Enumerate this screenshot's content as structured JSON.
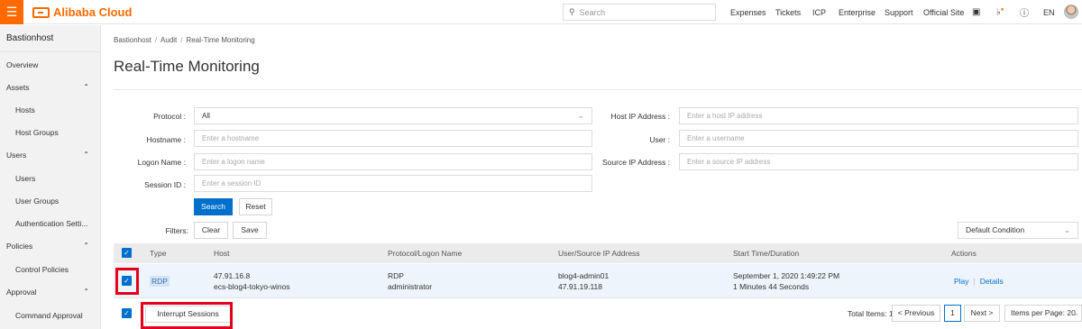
{
  "topbar": {
    "menu_icon": "☰",
    "brand": "Alibaba Cloud",
    "search_placeholder": "Search",
    "nav": [
      "Expenses",
      "Tickets",
      "ICP",
      "Enterprise",
      "Support",
      "Official Site"
    ],
    "lang": "EN",
    "accent": "#ff6a00"
  },
  "sidebar": {
    "title": "Bastionhost",
    "items": [
      {
        "label": "Overview",
        "level": 1
      },
      {
        "label": "Assets",
        "level": 1,
        "expanded": true
      },
      {
        "label": "Hosts",
        "level": 2
      },
      {
        "label": "Host Groups",
        "level": 2
      },
      {
        "label": "Users",
        "level": 1,
        "expanded": true
      },
      {
        "label": "Users",
        "level": 2
      },
      {
        "label": "User Groups",
        "level": 2
      },
      {
        "label": "Authentication Setti...",
        "level": 2
      },
      {
        "label": "Policies",
        "level": 1,
        "expanded": true
      },
      {
        "label": "Control Policies",
        "level": 2
      },
      {
        "label": "Approval",
        "level": 1,
        "expanded": true
      },
      {
        "label": "Command Approval",
        "level": 2
      }
    ]
  },
  "breadcrumb": [
    "Bastionhost",
    "Audit",
    "Real-Time Monitoring"
  ],
  "page_title": "Real-Time Monitoring",
  "filters": {
    "protocol_label": "Protocol",
    "protocol_value": "All",
    "hostname_label": "Hostname",
    "hostname_placeholder": "Enter a hostname",
    "logon_label": "Logon Name",
    "logon_placeholder": "Enter a logon name",
    "session_label": "Session ID",
    "session_placeholder": "Enter a session ID",
    "host_ip_label": "Host IP Address",
    "host_ip_placeholder": "Enter a host IP address",
    "user_label": "User",
    "user_placeholder": "Enter a username",
    "source_ip_label": "Source IP Address",
    "source_ip_placeholder": "Enter a source IP address",
    "search_btn": "Search",
    "reset_btn": "Reset",
    "filters_label": "Filters",
    "clear_btn": "Clear",
    "save_btn": "Save",
    "condition_select": "Default Condition"
  },
  "table": {
    "columns": [
      "Type",
      "Host",
      "Protocol/Logon Name",
      "User/Source IP Address",
      "Start Time/Duration",
      "Actions"
    ],
    "rows": [
      {
        "type": "RDP",
        "host_ip": "47.91.16.8",
        "host_name": "ecs-blog4-tokyo-winos",
        "protocol": "RDP",
        "logon": "administrator",
        "user": "blog4-admin01",
        "source_ip": "47.91.19.118",
        "start": "September 1, 2020 1:49:22 PM",
        "duration": "1 Minutes 44 Seconds",
        "action_play": "Play",
        "action_details": "Details",
        "selected": true
      }
    ],
    "interrupt_btn": "Interrupt Sessions"
  },
  "pager": {
    "total_label": "Total Items: 1",
    "prev": "Previous",
    "current": "1",
    "next": "Next",
    "per_page": "Items per Page: 20"
  },
  "colors": {
    "primary": "#0070cc",
    "highlight": "#e4001b"
  }
}
